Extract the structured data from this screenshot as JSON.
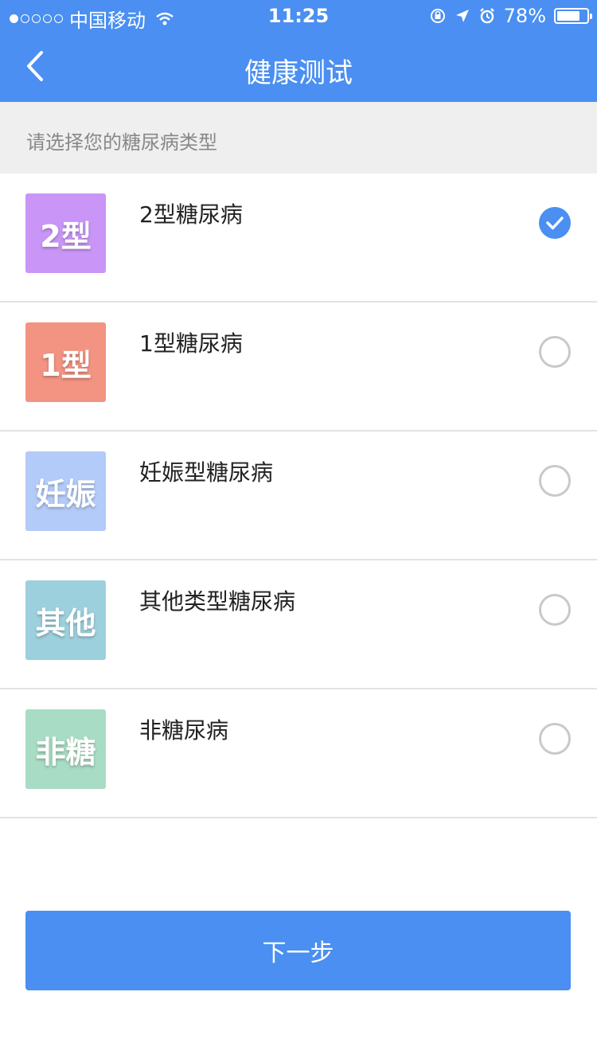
{
  "status_bar": {
    "carrier": "中国移动",
    "time": "11:25",
    "battery_percent": "78%",
    "battery_level": 0.78,
    "icons": [
      "signal-icon",
      "wifi-icon",
      "orientation-lock-icon",
      "location-icon",
      "alarm-icon",
      "battery-icon"
    ]
  },
  "nav": {
    "title": "健康测试",
    "back_icon": "chevron-left-icon"
  },
  "section_header": "请选择您的糖尿病类型",
  "options": [
    {
      "tile_text": "2型",
      "label": "2型糖尿病",
      "color": "#c995f7",
      "selected": true
    },
    {
      "tile_text": "1型",
      "label": "1型糖尿病",
      "color": "#f39382",
      "selected": false
    },
    {
      "tile_text": "妊娠",
      "label": "妊娠型糖尿病",
      "color": "#b3cbf8",
      "selected": false
    },
    {
      "tile_text": "其他",
      "label": "其他类型糖尿病",
      "color": "#9dd0dd",
      "selected": false
    },
    {
      "tile_text": "非糖",
      "label": "非糖尿病",
      "color": "#a9dcc4",
      "selected": false
    }
  ],
  "next_button": "下一步",
  "colors": {
    "primary": "#4a8ff1",
    "header_bg": "#efefef",
    "divider": "#e3e3e3",
    "radio_border": "#c9c9c9"
  }
}
